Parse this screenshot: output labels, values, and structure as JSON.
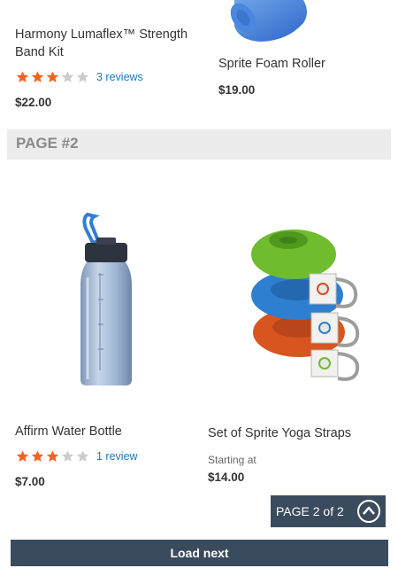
{
  "products_page1": [
    {
      "name": "Harmony Lumaflex™ Strength Band Kit",
      "rating": 3,
      "rating_max": 5,
      "reviews": "3 reviews",
      "price": "$22.00"
    },
    {
      "name": "Sprite Foam Roller",
      "price": "$19.00"
    }
  ],
  "page_divider": "PAGE #2",
  "products_page2": [
    {
      "name": "Affirm Water Bottle",
      "rating": 3,
      "rating_max": 5,
      "reviews": "1 review",
      "price": "$7.00"
    },
    {
      "name": "Set of Sprite Yoga Straps",
      "starting_label": "Starting at",
      "price": "$14.00"
    }
  ],
  "pagination": {
    "label": "PAGE 2 of 2"
  },
  "load_next": "Load next",
  "colors": {
    "star_filled": "#f26322",
    "star_empty": "#cccccc",
    "link": "#1979c3",
    "button_bg": "#3b4b5e"
  },
  "icons": {
    "scroll_up": "chevron-up-circle-icon",
    "star": "star-icon"
  }
}
